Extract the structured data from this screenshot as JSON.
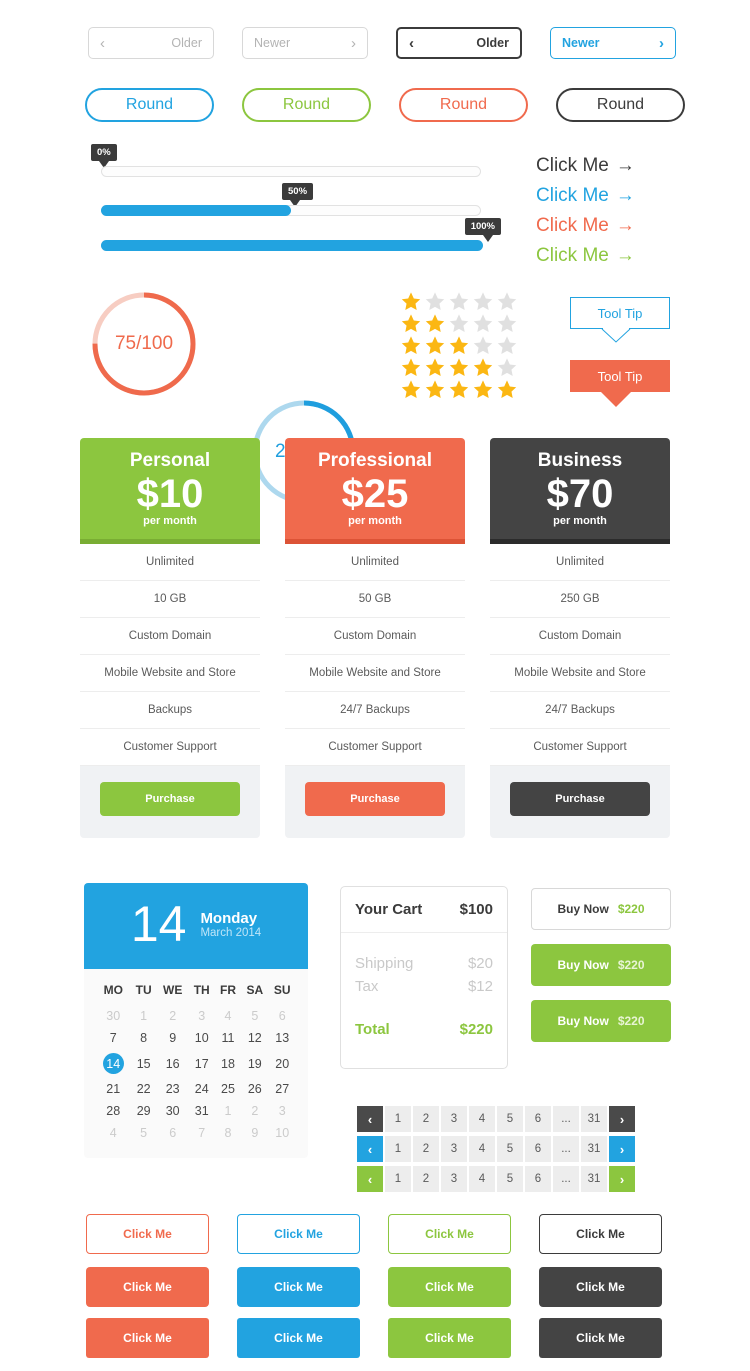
{
  "nav_buttons": [
    {
      "label": "Older",
      "arrow": "‹",
      "arrow_side": "left",
      "style": "grey-old"
    },
    {
      "label": "Newer",
      "arrow": "›",
      "arrow_side": "right",
      "style": "grey-new"
    },
    {
      "label": "Older",
      "arrow": "‹",
      "arrow_side": "left",
      "style": "dark-old"
    },
    {
      "label": "Newer",
      "arrow": "›",
      "arrow_side": "right",
      "style": "blue-new"
    }
  ],
  "round_buttons": [
    {
      "label": "Round",
      "style": "blue"
    },
    {
      "label": "Round",
      "style": "green"
    },
    {
      "label": "Round",
      "style": "red"
    },
    {
      "label": "Round",
      "style": "dark"
    }
  ],
  "progress_bars": [
    {
      "label": "0%",
      "percent": 0
    },
    {
      "label": "50%",
      "percent": 50
    },
    {
      "label": "100%",
      "percent": 100
    }
  ],
  "arrow_links": [
    {
      "label": "Click Me",
      "arrow": "→",
      "style": "dark"
    },
    {
      "label": "Click Me",
      "arrow": "→",
      "style": "blue"
    },
    {
      "label": "Click Me",
      "arrow": "→",
      "style": "red"
    },
    {
      "label": "Click Me",
      "arrow": "→",
      "style": "green"
    }
  ],
  "rings": [
    {
      "value": "75/100",
      "percent": 75,
      "color": "#ef6a4c",
      "track": "#f7cdc2"
    },
    {
      "value": "25/100",
      "percent": 25,
      "color": "#1f9ede",
      "track": "#add8ee"
    }
  ],
  "star_rating": {
    "rows": [
      1,
      2,
      3,
      4,
      5
    ],
    "total": 5,
    "filled_color": "#fbb713",
    "empty_color": "#e0e0e0"
  },
  "tooltips": [
    {
      "label": "Tool Tip",
      "style": "outline"
    },
    {
      "label": "Tool Tip",
      "style": "solid"
    }
  ],
  "pricing": {
    "cards": [
      {
        "name": "Personal",
        "price": "$10",
        "per": "per month",
        "color": "#8cc63f",
        "accent": "#79ad33",
        "features": [
          "Unlimited",
          "10 GB",
          "Custom Domain",
          "Mobile Website and Store",
          "Backups",
          "Customer Support"
        ],
        "cta": "Purchase"
      },
      {
        "name": "Professional",
        "price": "$25",
        "per": "per month",
        "color": "#f06a4d",
        "accent": "#dc5336",
        "features": [
          "Unlimited",
          "50 GB",
          "Custom Domain",
          "Mobile Website and Store",
          "24/7 Backups",
          "Customer Support"
        ],
        "cta": "Purchase"
      },
      {
        "name": "Business",
        "price": "$70",
        "per": "per month",
        "color": "#444444",
        "accent": "#2b2b2b",
        "features": [
          "Unlimited",
          "250 GB",
          "Custom Domain",
          "Mobile Website and Store",
          "24/7 Backups",
          "Customer Support"
        ],
        "cta": "Purchase"
      }
    ]
  },
  "calendar": {
    "day_number": "14",
    "weekday": "Monday",
    "month_year": "March 2014",
    "weekday_headers": [
      "MO",
      "TU",
      "WE",
      "TH",
      "FR",
      "SA",
      "SU"
    ],
    "selected_day": 14,
    "weeks": [
      [
        {
          "d": "30",
          "mut": true
        },
        {
          "d": "1",
          "mut": true
        },
        {
          "d": "2",
          "mut": true
        },
        {
          "d": "3",
          "mut": true
        },
        {
          "d": "4",
          "mut": true
        },
        {
          "d": "5",
          "mut": true
        },
        {
          "d": "6",
          "mut": true
        }
      ],
      [
        {
          "d": "7"
        },
        {
          "d": "8"
        },
        {
          "d": "9"
        },
        {
          "d": "10"
        },
        {
          "d": "11"
        },
        {
          "d": "12"
        },
        {
          "d": "13"
        }
      ],
      [
        {
          "d": "14",
          "sel": true
        },
        {
          "d": "15"
        },
        {
          "d": "16"
        },
        {
          "d": "17"
        },
        {
          "d": "18"
        },
        {
          "d": "19"
        },
        {
          "d": "20"
        }
      ],
      [
        {
          "d": "21"
        },
        {
          "d": "22"
        },
        {
          "d": "23"
        },
        {
          "d": "24"
        },
        {
          "d": "25"
        },
        {
          "d": "26"
        },
        {
          "d": "27"
        }
      ],
      [
        {
          "d": "28"
        },
        {
          "d": "29"
        },
        {
          "d": "30"
        },
        {
          "d": "31"
        },
        {
          "d": "1",
          "mut": true
        },
        {
          "d": "2",
          "mut": true
        },
        {
          "d": "3",
          "mut": true
        }
      ],
      [
        {
          "d": "4",
          "mut": true
        },
        {
          "d": "5",
          "mut": true
        },
        {
          "d": "6",
          "mut": true
        },
        {
          "d": "7",
          "mut": true
        },
        {
          "d": "8",
          "mut": true
        },
        {
          "d": "9",
          "mut": true
        },
        {
          "d": "10",
          "mut": true
        }
      ]
    ]
  },
  "cart": {
    "title": "Your Cart",
    "subtotal": "$100",
    "lines": [
      {
        "label": "Shipping",
        "amount": "$20"
      },
      {
        "label": "Tax",
        "amount": "$12"
      }
    ],
    "total_label": "Total",
    "total_amount": "$220"
  },
  "buy_buttons": [
    {
      "label": "Buy Now",
      "amount": "$220",
      "style": "outline"
    },
    {
      "label": "Buy Now",
      "amount": "$220",
      "style": "green"
    },
    {
      "label": "Buy Now",
      "amount": "$220",
      "style": "green"
    }
  ],
  "pagers": [
    {
      "prev": "‹",
      "next": "›",
      "pages": [
        "1",
        "2",
        "3",
        "4",
        "5",
        "6",
        "...",
        "31"
      ],
      "style": "dark"
    },
    {
      "prev": "‹",
      "next": "›",
      "pages": [
        "1",
        "2",
        "3",
        "4",
        "5",
        "6",
        "...",
        "31"
      ],
      "style": "blue"
    },
    {
      "prev": "‹",
      "next": "›",
      "pages": [
        "1",
        "2",
        "3",
        "4",
        "5",
        "6",
        "...",
        "31"
      ],
      "style": "green"
    }
  ],
  "click_buttons": {
    "row1": [
      {
        "label": "Click Me",
        "style": "o-red"
      },
      {
        "label": "Click Me",
        "style": "o-blue"
      },
      {
        "label": "Click Me",
        "style": "o-green"
      },
      {
        "label": "Click Me",
        "style": "o-dark"
      }
    ],
    "row2": [
      {
        "label": "Click Me",
        "style": "f-red"
      },
      {
        "label": "Click Me",
        "style": "f-blue"
      },
      {
        "label": "Click Me",
        "style": "f-green"
      },
      {
        "label": "Click Me",
        "style": "f-dark"
      }
    ],
    "row3": [
      {
        "label": "Click Me",
        "style": "f-red"
      },
      {
        "label": "Click Me",
        "style": "f-blue"
      },
      {
        "label": "Click Me",
        "style": "f-green"
      },
      {
        "label": "Click Me",
        "style": "f-dark"
      }
    ]
  }
}
